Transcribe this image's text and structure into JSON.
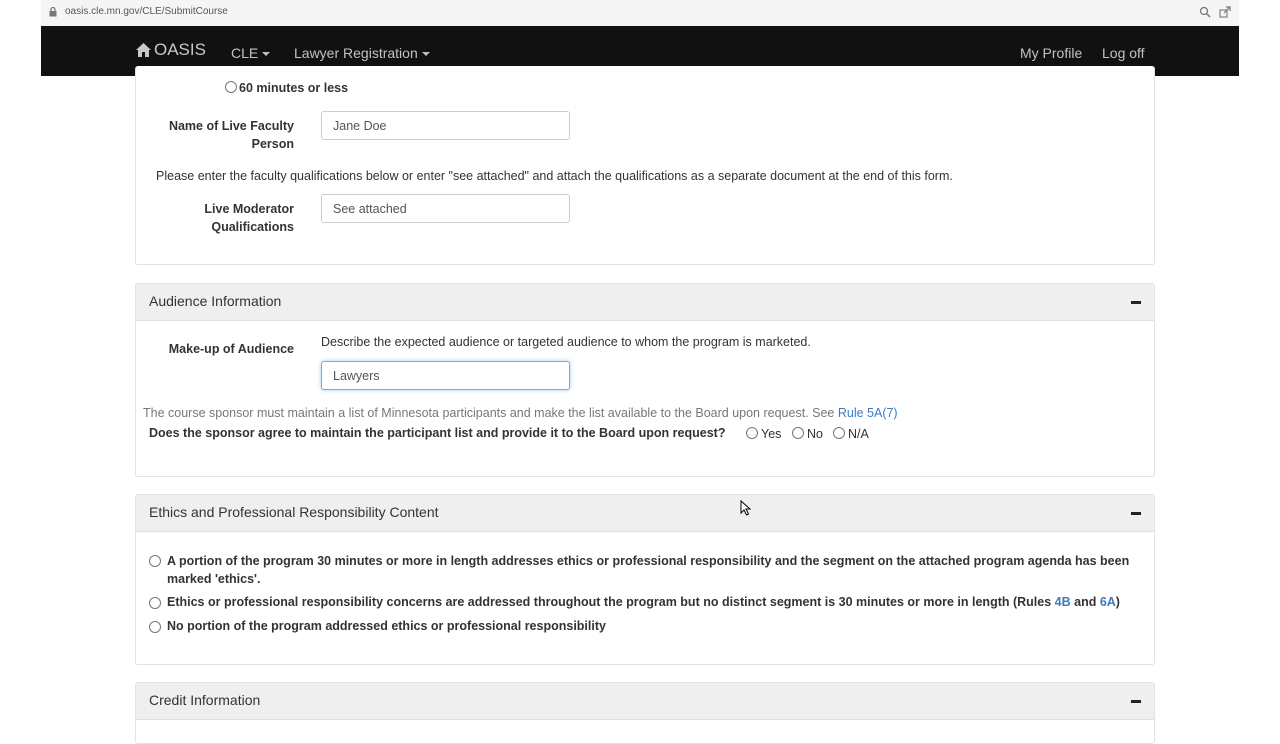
{
  "browser": {
    "url": "oasis.cle.mn.gov/CLE/SubmitCourse"
  },
  "navbar": {
    "brand": "OASIS",
    "items": [
      {
        "label": "CLE"
      },
      {
        "label": "Lawyer Registration"
      }
    ],
    "right_items": [
      {
        "label": "My Profile"
      },
      {
        "label": "Log off"
      }
    ]
  },
  "faculty": {
    "duration_option": "60 minutes or less",
    "name_label_line1": "Name of Live Faculty",
    "name_label_line2": "Person",
    "name_value": "Jane Doe",
    "instructions": "Please enter the faculty qualifications below or enter \"see attached\" and attach the qualifications as a separate document at the end of this form.",
    "qual_label_line1": "Live Moderator",
    "qual_label_line2": "Qualifications",
    "qual_value": "See attached"
  },
  "audience": {
    "title": "Audience Information",
    "makeup_label": "Make-up of Audience",
    "makeup_help": "Describe the expected audience or targeted audience to whom the program is marketed.",
    "makeup_value": "Lawyers",
    "sponsor_note": "The course sponsor must maintain a list of Minnesota participants and make the list available to the Board upon request. See ",
    "sponsor_rule_link": "Rule 5A(7)",
    "question": "Does the sponsor agree to maintain the participant list and provide it to the Board upon request?",
    "options": [
      "Yes",
      "No",
      "N/A"
    ]
  },
  "ethics": {
    "title": "Ethics and Professional Responsibility Content",
    "option1_line1": "A portion of the program 30 minutes or more in length addresses ethics or professional responsibility and the segment on the attached program agenda has been",
    "option1_line2": "marked 'ethics'.",
    "option2_text": "Ethics or professional responsibility concerns are addressed throughout the program but no distinct segment is 30 minutes or more in length (Rules ",
    "option2_link1": "4B",
    "option2_and": " and ",
    "option2_link2": "6A",
    "option2_close": ")",
    "option3": "No portion of the program addressed ethics or professional responsibility"
  },
  "credit": {
    "title": "Credit Information"
  }
}
